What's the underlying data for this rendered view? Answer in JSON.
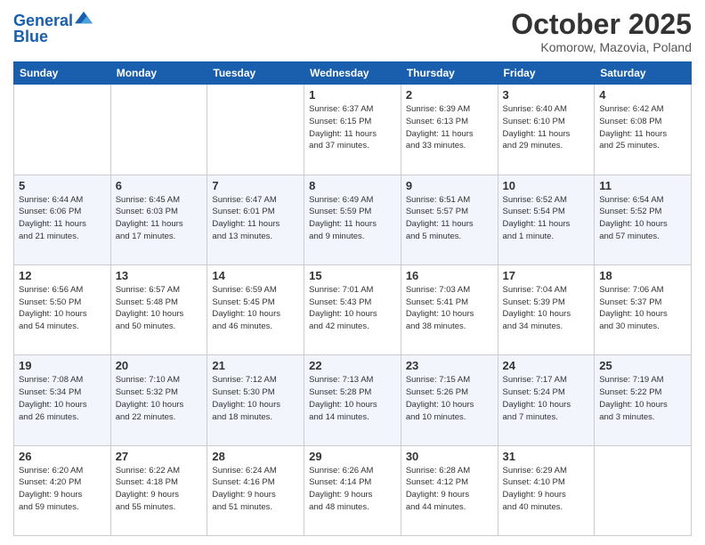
{
  "header": {
    "logo_line1": "General",
    "logo_line2": "Blue",
    "month_title": "October 2025",
    "location": "Komorow, Mazovia, Poland"
  },
  "days_of_week": [
    "Sunday",
    "Monday",
    "Tuesday",
    "Wednesday",
    "Thursday",
    "Friday",
    "Saturday"
  ],
  "weeks": [
    [
      {
        "day": "",
        "info": ""
      },
      {
        "day": "",
        "info": ""
      },
      {
        "day": "",
        "info": ""
      },
      {
        "day": "1",
        "info": "Sunrise: 6:37 AM\nSunset: 6:15 PM\nDaylight: 11 hours\nand 37 minutes."
      },
      {
        "day": "2",
        "info": "Sunrise: 6:39 AM\nSunset: 6:13 PM\nDaylight: 11 hours\nand 33 minutes."
      },
      {
        "day": "3",
        "info": "Sunrise: 6:40 AM\nSunset: 6:10 PM\nDaylight: 11 hours\nand 29 minutes."
      },
      {
        "day": "4",
        "info": "Sunrise: 6:42 AM\nSunset: 6:08 PM\nDaylight: 11 hours\nand 25 minutes."
      }
    ],
    [
      {
        "day": "5",
        "info": "Sunrise: 6:44 AM\nSunset: 6:06 PM\nDaylight: 11 hours\nand 21 minutes."
      },
      {
        "day": "6",
        "info": "Sunrise: 6:45 AM\nSunset: 6:03 PM\nDaylight: 11 hours\nand 17 minutes."
      },
      {
        "day": "7",
        "info": "Sunrise: 6:47 AM\nSunset: 6:01 PM\nDaylight: 11 hours\nand 13 minutes."
      },
      {
        "day": "8",
        "info": "Sunrise: 6:49 AM\nSunset: 5:59 PM\nDaylight: 11 hours\nand 9 minutes."
      },
      {
        "day": "9",
        "info": "Sunrise: 6:51 AM\nSunset: 5:57 PM\nDaylight: 11 hours\nand 5 minutes."
      },
      {
        "day": "10",
        "info": "Sunrise: 6:52 AM\nSunset: 5:54 PM\nDaylight: 11 hours\nand 1 minute."
      },
      {
        "day": "11",
        "info": "Sunrise: 6:54 AM\nSunset: 5:52 PM\nDaylight: 10 hours\nand 57 minutes."
      }
    ],
    [
      {
        "day": "12",
        "info": "Sunrise: 6:56 AM\nSunset: 5:50 PM\nDaylight: 10 hours\nand 54 minutes."
      },
      {
        "day": "13",
        "info": "Sunrise: 6:57 AM\nSunset: 5:48 PM\nDaylight: 10 hours\nand 50 minutes."
      },
      {
        "day": "14",
        "info": "Sunrise: 6:59 AM\nSunset: 5:45 PM\nDaylight: 10 hours\nand 46 minutes."
      },
      {
        "day": "15",
        "info": "Sunrise: 7:01 AM\nSunset: 5:43 PM\nDaylight: 10 hours\nand 42 minutes."
      },
      {
        "day": "16",
        "info": "Sunrise: 7:03 AM\nSunset: 5:41 PM\nDaylight: 10 hours\nand 38 minutes."
      },
      {
        "day": "17",
        "info": "Sunrise: 7:04 AM\nSunset: 5:39 PM\nDaylight: 10 hours\nand 34 minutes."
      },
      {
        "day": "18",
        "info": "Sunrise: 7:06 AM\nSunset: 5:37 PM\nDaylight: 10 hours\nand 30 minutes."
      }
    ],
    [
      {
        "day": "19",
        "info": "Sunrise: 7:08 AM\nSunset: 5:34 PM\nDaylight: 10 hours\nand 26 minutes."
      },
      {
        "day": "20",
        "info": "Sunrise: 7:10 AM\nSunset: 5:32 PM\nDaylight: 10 hours\nand 22 minutes."
      },
      {
        "day": "21",
        "info": "Sunrise: 7:12 AM\nSunset: 5:30 PM\nDaylight: 10 hours\nand 18 minutes."
      },
      {
        "day": "22",
        "info": "Sunrise: 7:13 AM\nSunset: 5:28 PM\nDaylight: 10 hours\nand 14 minutes."
      },
      {
        "day": "23",
        "info": "Sunrise: 7:15 AM\nSunset: 5:26 PM\nDaylight: 10 hours\nand 10 minutes."
      },
      {
        "day": "24",
        "info": "Sunrise: 7:17 AM\nSunset: 5:24 PM\nDaylight: 10 hours\nand 7 minutes."
      },
      {
        "day": "25",
        "info": "Sunrise: 7:19 AM\nSunset: 5:22 PM\nDaylight: 10 hours\nand 3 minutes."
      }
    ],
    [
      {
        "day": "26",
        "info": "Sunrise: 6:20 AM\nSunset: 4:20 PM\nDaylight: 9 hours\nand 59 minutes."
      },
      {
        "day": "27",
        "info": "Sunrise: 6:22 AM\nSunset: 4:18 PM\nDaylight: 9 hours\nand 55 minutes."
      },
      {
        "day": "28",
        "info": "Sunrise: 6:24 AM\nSunset: 4:16 PM\nDaylight: 9 hours\nand 51 minutes."
      },
      {
        "day": "29",
        "info": "Sunrise: 6:26 AM\nSunset: 4:14 PM\nDaylight: 9 hours\nand 48 minutes."
      },
      {
        "day": "30",
        "info": "Sunrise: 6:28 AM\nSunset: 4:12 PM\nDaylight: 9 hours\nand 44 minutes."
      },
      {
        "day": "31",
        "info": "Sunrise: 6:29 AM\nSunset: 4:10 PM\nDaylight: 9 hours\nand 40 minutes."
      },
      {
        "day": "",
        "info": ""
      }
    ]
  ]
}
